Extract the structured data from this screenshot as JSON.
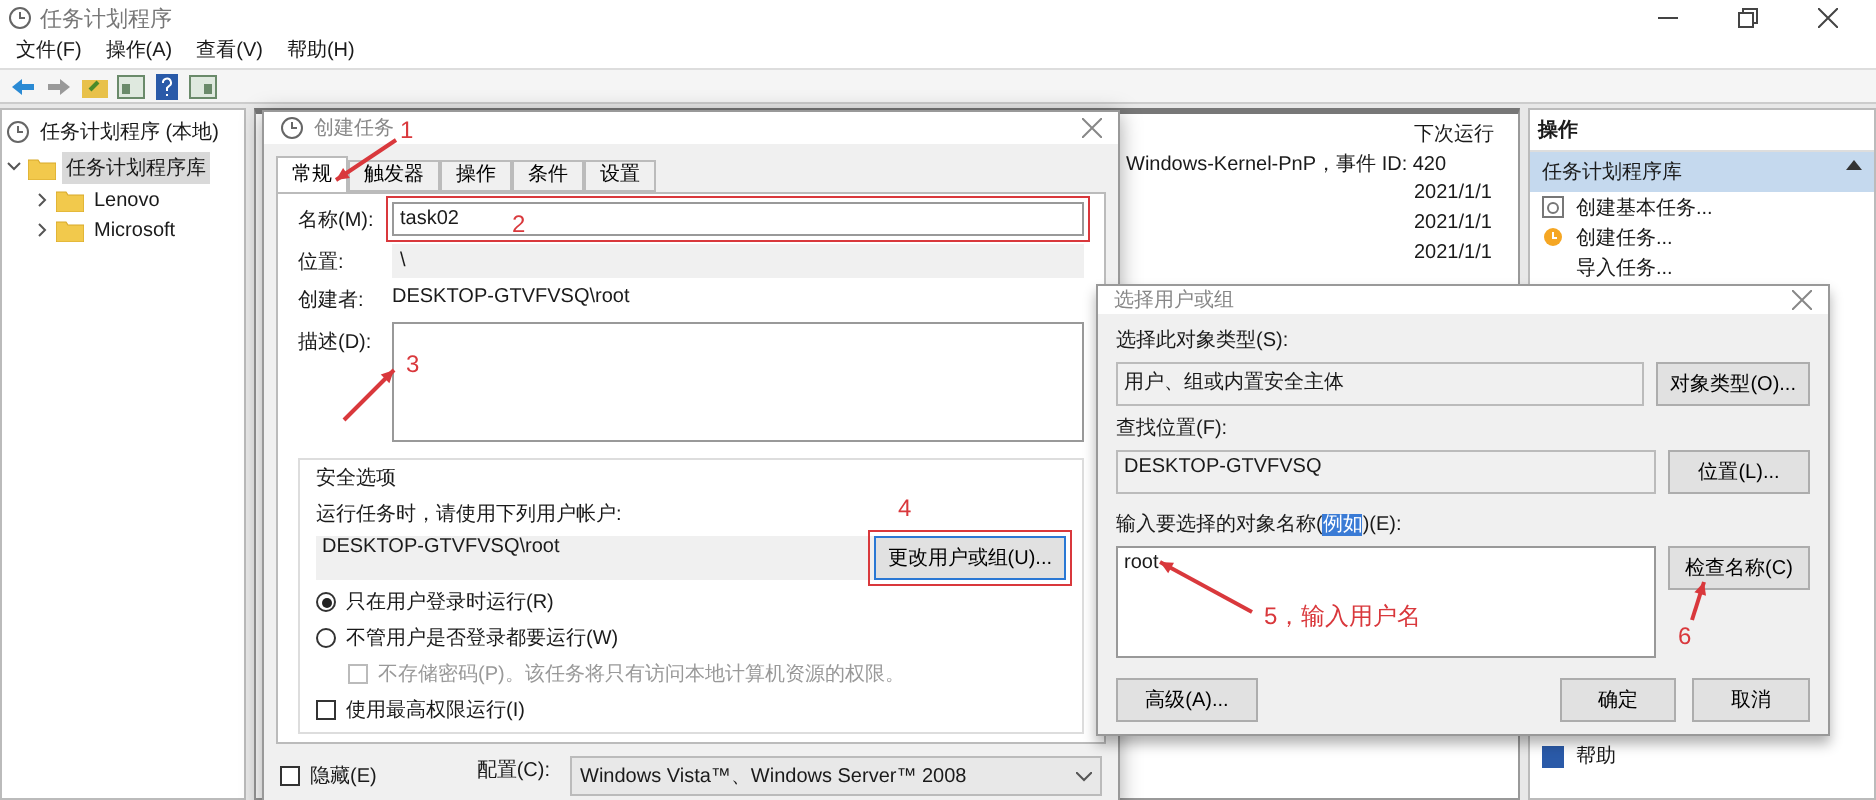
{
  "window": {
    "title": "任务计划程序"
  },
  "menu": [
    "文件(F)",
    "操作(A)",
    "查看(V)",
    "帮助(H)"
  ],
  "tree": {
    "root": "任务计划程序 (本地)",
    "items": [
      {
        "label": "任务计划程序库",
        "selected": true,
        "expanded": true,
        "children": [
          {
            "label": "Lenovo",
            "selected": false,
            "expanded": false
          },
          {
            "label": "Microsoft",
            "selected": false,
            "expanded": false
          }
        ]
      }
    ]
  },
  "task_list": {
    "column": "下次运行",
    "trigger_text": "Windows-Kernel-PnP，事件 ID: 420",
    "dates": [
      "2021/1/1",
      "2021/1/1",
      "2021/1/1"
    ]
  },
  "actions_panel": {
    "title": "操作",
    "section": "任务计划程序库",
    "items": [
      {
        "label": "创建基本任务...",
        "kind": "wizard"
      },
      {
        "label": "创建任务...",
        "kind": "task"
      },
      {
        "label": "导入任务...",
        "kind": "plain"
      }
    ],
    "help": "帮助"
  },
  "create_task": {
    "title": "创建任务",
    "tabs": [
      {
        "label": "常规",
        "selected": true
      },
      {
        "label": "触发器",
        "selected": false
      },
      {
        "label": "操作",
        "selected": false
      },
      {
        "label": "条件",
        "selected": false
      },
      {
        "label": "设置",
        "selected": false
      }
    ],
    "name_label": "名称(M):",
    "name": "task02",
    "location_label": "位置:",
    "location": "\\",
    "author_label": "创建者:",
    "author": "DESKTOP-GTVFVSQ\\root",
    "description_label": "描述(D):",
    "security": {
      "title": "安全选项",
      "account_label": "运行任务时，请使用下列用户帐户:",
      "account": "DESKTOP-GTVFVSQ\\root",
      "change_button": "更改用户或组(U)...",
      "options": [
        {
          "label": "只在用户登录时运行(R)",
          "selected": true
        },
        {
          "label": "不管用户是否登录都要运行(W)",
          "selected": false
        }
      ],
      "no_password": {
        "label": "不存储密码(P)。该任务将只有访问本地计算机资源的权限。",
        "checked": false,
        "disabled": true
      },
      "highest": {
        "label": "使用最高权限运行(I)",
        "checked": false,
        "disabled": false
      }
    },
    "hidden": {
      "label": "隐藏(E)",
      "checked": false
    },
    "config_label": "配置(C):",
    "config": "Windows Vista™、Windows Server™ 2008"
  },
  "select_user": {
    "title": "选择用户或组",
    "type_label": "选择此对象类型(S):",
    "type": "用户、组或内置安全主体",
    "type_button": "对象类型(O)...",
    "location_label": "查找位置(F):",
    "location": "DESKTOP-GTVFVSQ",
    "location_button": "位置(L)...",
    "names_label_before": "输入要选择的对象名称(",
    "names_link": "例如",
    "names_label_after": ")(E):",
    "names": "root",
    "check_button": "检查名称(C)",
    "advanced_button": "高级(A)...",
    "ok_button": "确定",
    "cancel_button": "取消"
  },
  "annotations": [
    {
      "label": "1"
    },
    {
      "label": "2"
    },
    {
      "label": "3"
    },
    {
      "label": "4"
    },
    {
      "label": "5，输入用户名"
    },
    {
      "label": "6"
    }
  ]
}
